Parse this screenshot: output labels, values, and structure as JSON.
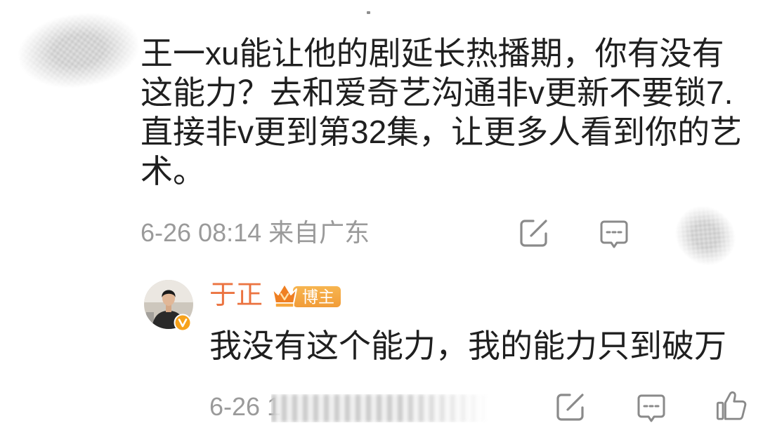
{
  "comment": {
    "text_lines": [
      "王一xu能让他的剧延长热播期，你有没有",
      "这能力？去和爱奇艺沟通非v更新不要锁7.",
      "直接非v更到第32集，让更多人看到你的艺",
      "术。"
    ],
    "timestamp": "6-26 08:14",
    "source": "来自广东",
    "actions": {
      "share_icon": "share-icon",
      "comment_icon": "comment-icon"
    }
  },
  "reply": {
    "author_name": "于正",
    "verified_icon": "verified-v-icon",
    "badge_icon": "crown-icon",
    "badge_label": "博主",
    "text": "我没有这个能力，我的能力只到破万",
    "timestamp": "6-26 1",
    "actions": {
      "share_icon": "share-icon",
      "comment_icon": "comment-icon",
      "like_icon": "thumbs-up-icon"
    }
  },
  "colors": {
    "text": "#1f1f1f",
    "meta": "#9a9a9a",
    "icon": "#8a8a8a",
    "accent": "#eb7340",
    "badge": "#f19c38"
  }
}
